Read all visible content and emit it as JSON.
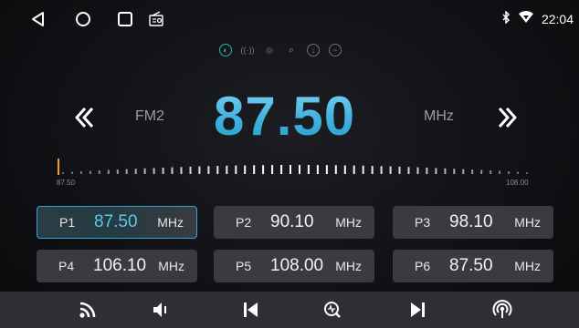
{
  "status": {
    "time": "22:04"
  },
  "tuner": {
    "band": "FM2",
    "frequency": "87.50",
    "unit": "MHz"
  },
  "scale": {
    "min_label": "87.50",
    "max_label": "108.00"
  },
  "presets": [
    {
      "name": "P1",
      "freq": "87.50",
      "unit": "MHz"
    },
    {
      "name": "P2",
      "freq": "90.10",
      "unit": "MHz"
    },
    {
      "name": "P3",
      "freq": "98.10",
      "unit": "MHz"
    },
    {
      "name": "P4",
      "freq": "106.10",
      "unit": "MHz"
    },
    {
      "name": "P5",
      "freq": "108.00",
      "unit": "MHz"
    },
    {
      "name": "P6",
      "freq": "87.50",
      "unit": "MHz"
    }
  ],
  "colors": {
    "accent": "#27b3b3",
    "frequency": "#4fbfe8",
    "preset_bg": "#3a3b40",
    "bottom_bar": "#2e2f34"
  }
}
